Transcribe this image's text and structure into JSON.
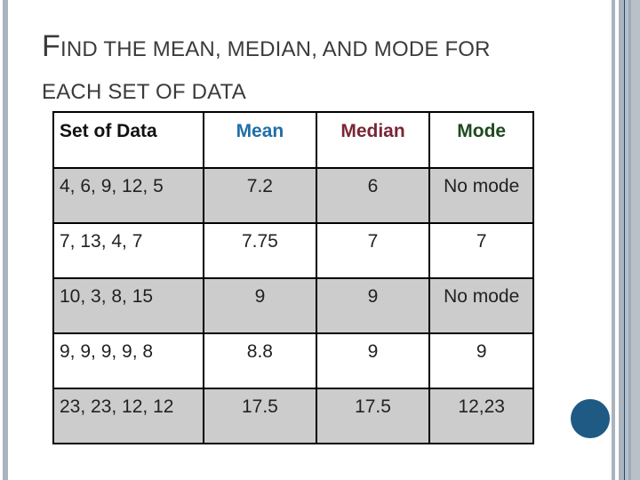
{
  "slide": {
    "title_first_letter": "F",
    "title_line1_rest": "IND THE MEAN, MEDIAN, AND MODE FOR",
    "title_line2": "EACH SET OF DATA"
  },
  "table": {
    "headers": [
      {
        "label": "Set of Data",
        "color": "#111111"
      },
      {
        "label": "Mean",
        "color": "#1f6fa6"
      },
      {
        "label": "Median",
        "color": "#7a2535"
      },
      {
        "label": "Mode",
        "color": "#1f4a1f"
      }
    ],
    "rows": [
      {
        "set": "4, 6, 9, 12, 5",
        "mean": "7.2",
        "median": "6",
        "mode": "No mode"
      },
      {
        "set": "7, 13, 4, 7",
        "mean": "7.75",
        "median": "7",
        "mode": "7"
      },
      {
        "set": "10, 3, 8, 15",
        "mean": "9",
        "median": "9",
        "mode": "No mode"
      },
      {
        "set": "9, 9, 9, 9, 8",
        "mean": "8.8",
        "median": "9",
        "mode": "9"
      },
      {
        "set": "23, 23, 12, 12",
        "mean": "17.5",
        "median": "17.5",
        "mode": "12,23"
      }
    ]
  },
  "colors": {
    "accent_dot": "#1f5a85",
    "row_shade": "#cccccc"
  }
}
